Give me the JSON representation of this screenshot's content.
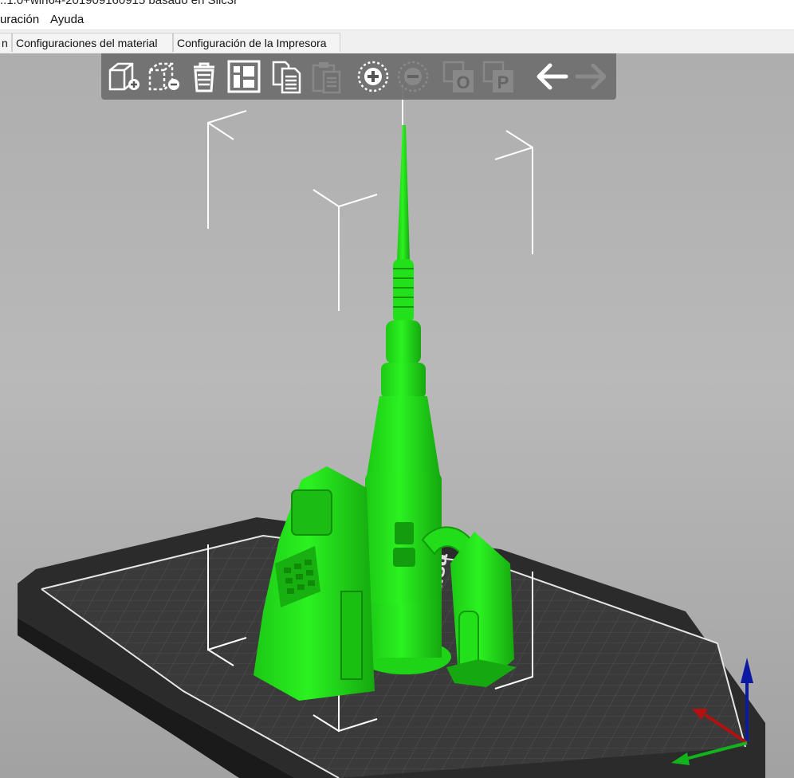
{
  "window": {
    "title": "..1.0+win64-201909160915 basado en Slic3r"
  },
  "menu": {
    "items": [
      {
        "label": "uración"
      },
      {
        "label": "Ayuda"
      }
    ]
  },
  "tabs": [
    {
      "label": "n"
    },
    {
      "label": "Configuraciones del material"
    },
    {
      "label": "Configuración de la Impresora"
    }
  ],
  "toolbar": {
    "buttons": [
      {
        "name": "add-object",
        "icon": "cube-plus-icon",
        "enabled": true
      },
      {
        "name": "remove-object",
        "icon": "cube-minus-icon",
        "enabled": true
      },
      {
        "name": "delete-all",
        "icon": "trash-icon",
        "enabled": true
      },
      {
        "name": "arrange",
        "icon": "arrange-icon",
        "enabled": true
      },
      {
        "name": "copy",
        "icon": "copy-icon",
        "enabled": true
      },
      {
        "name": "paste",
        "icon": "paste-icon",
        "enabled": false
      },
      {
        "name": "add-instance",
        "icon": "plus-circle-icon",
        "enabled": true
      },
      {
        "name": "remove-instance",
        "icon": "minus-circle-icon",
        "enabled": false
      },
      {
        "name": "split-objects",
        "icon": "split-objects-icon",
        "label": "O",
        "enabled": false
      },
      {
        "name": "split-parts",
        "icon": "split-parts-icon",
        "label": "P",
        "enabled": false
      },
      {
        "name": "undo",
        "icon": "arrow-left-icon",
        "enabled": true
      },
      {
        "name": "redo",
        "icon": "arrow-right-icon",
        "enabled": false
      }
    ]
  },
  "bed_label": "Prusa",
  "colors": {
    "model": "#22ee1a",
    "bed": "#353535",
    "background": "#b3b3b3",
    "axis_x": "#b31010",
    "axis_y": "#11b51b",
    "axis_z": "#0c1aa3"
  }
}
